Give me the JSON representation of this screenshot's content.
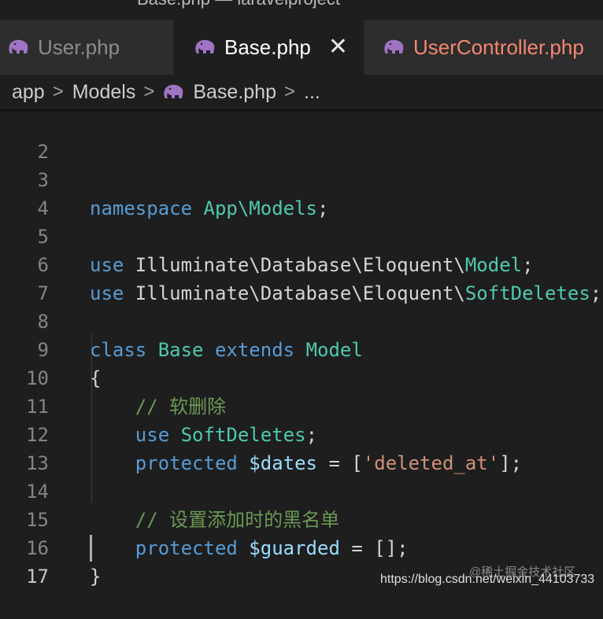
{
  "window": {
    "title": "Base.php — laravelproject"
  },
  "tabs": [
    {
      "label": "User.php",
      "icon": "php-elephant-icon",
      "active": false
    },
    {
      "label": "Base.php",
      "icon": "php-elephant-icon",
      "active": true,
      "close": "✕"
    },
    {
      "label": "UserController.php",
      "icon": "php-elephant-icon",
      "active": false,
      "modified": true
    }
  ],
  "breadcrumb": {
    "items": [
      "app",
      "Models",
      "Base.php",
      "..."
    ],
    "separator": ">"
  },
  "colors": {
    "keyword": "#569cd6",
    "class": "#4ec9b0",
    "string": "#ce9178",
    "variable": "#9cdcfe",
    "comment": "#6a9955",
    "text": "#d4d4d4",
    "php_icon": "#a074c4"
  },
  "editor": {
    "current_line": "17",
    "lines": [
      {
        "num": "2"
      },
      {
        "num": "3",
        "t0": "namespace",
        "t1": " ",
        "t2": "App\\Models",
        "t3": ";"
      },
      {
        "num": "4"
      },
      {
        "num": "5",
        "t0": "use",
        "t1": " Illuminate\\Database\\Eloquent\\",
        "t2": "Model",
        "t3": ";"
      },
      {
        "num": "6",
        "t0": "use",
        "t1": " Illuminate\\Database\\Eloquent\\",
        "t2": "SoftDeletes",
        "t3": ";"
      },
      {
        "num": "7"
      },
      {
        "num": "8",
        "t0": "class",
        "t1": " ",
        "t2": "Base",
        "t3": " ",
        "t4": "extends",
        "t5": " ",
        "t6": "Model"
      },
      {
        "num": "9",
        "t0": "{"
      },
      {
        "num": "10",
        "t0": "    // 软删除"
      },
      {
        "num": "11",
        "t0": "    ",
        "t1": "use",
        "t2": " ",
        "t3": "SoftDeletes",
        "t4": ";"
      },
      {
        "num": "12",
        "t0": "    ",
        "t1": "protected",
        "t2": " ",
        "t3": "$dates",
        "t4": " = [",
        "t5": "'deleted_at'",
        "t6": "];"
      },
      {
        "num": "13"
      },
      {
        "num": "14",
        "t0": "    // 设置添加时的黑名单"
      },
      {
        "num": "15",
        "t0": "    ",
        "t1": "protected",
        "t2": " ",
        "t3": "$guarded",
        "t4": " = [];"
      },
      {
        "num": "16",
        "t0": "}"
      },
      {
        "num": "17"
      }
    ]
  },
  "watermark": {
    "site": "@稀土掘金技术社区",
    "url": "https://blog.csdn.net/weixin_44103733"
  }
}
